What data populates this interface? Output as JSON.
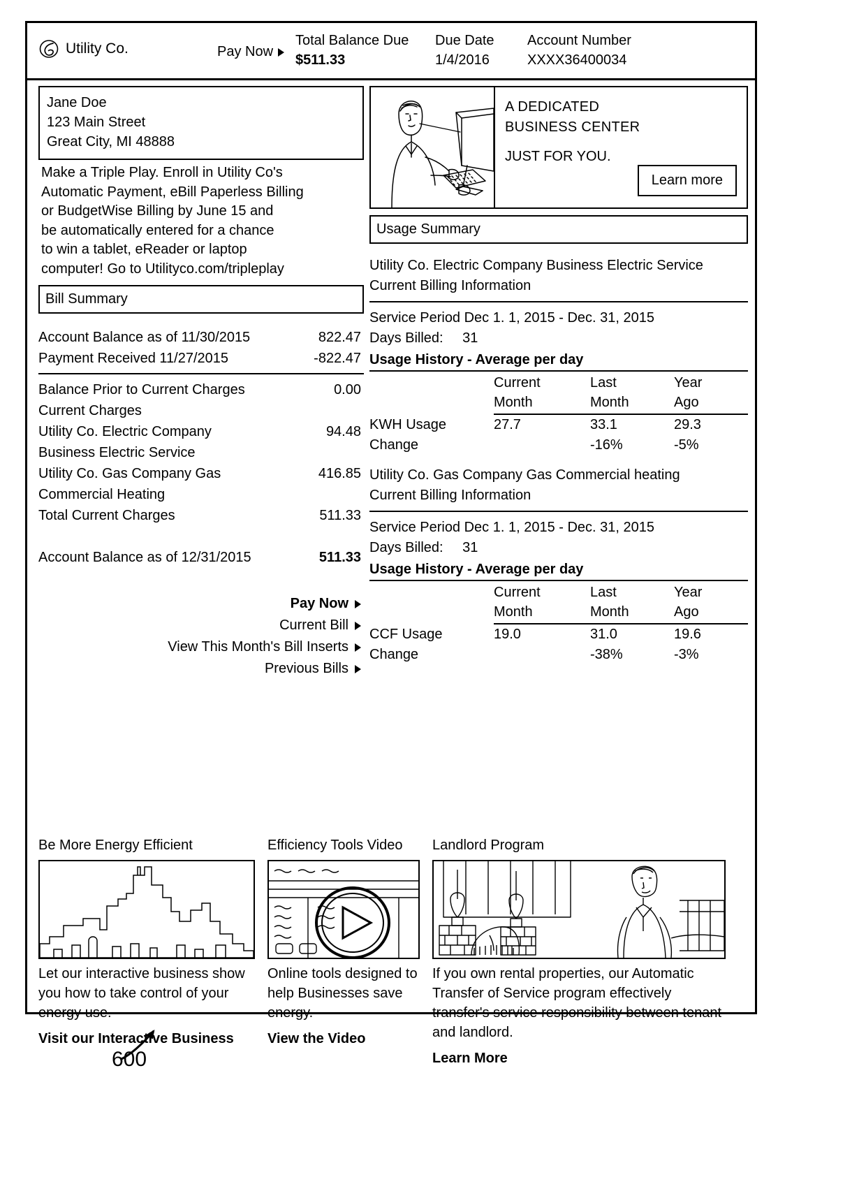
{
  "header": {
    "brand": "Utility Co.",
    "pay_now": "Pay Now",
    "total_balance_label": "Total Balance Due",
    "total_balance_value": "$511.33",
    "due_date_label": "Due Date",
    "due_date_value": "1/4/2016",
    "account_label": "Account Number",
    "account_value": "XXXX36400034"
  },
  "customer": {
    "name": "Jane Doe",
    "street": "123 Main Street",
    "citystate": "Great City, MI 48888"
  },
  "promo": {
    "line1": "Make a Triple Play. Enroll in Utility Co's",
    "line2": "Automatic Payment, eBill Paperless Billing",
    "line3": "or BudgetWise Billing by June 15 and",
    "line4": "be automatically entered for a chance",
    "line5": "to win a tablet, eReader or laptop",
    "line6": "computer! Go to Utilityco.com/tripleplay"
  },
  "ad": {
    "headline1": "A DEDICATED",
    "headline2": "BUSINESS CENTER",
    "headline3": "JUST FOR YOU.",
    "button": "Learn more"
  },
  "bill_summary": {
    "title": "Bill Summary",
    "rows": [
      {
        "label": "Account Balance as of 11/30/2015",
        "value": "822.47"
      },
      {
        "label": "Payment Received 11/27/2015",
        "value": "-822.47"
      }
    ],
    "balance_prior_label": "Balance Prior to Current Charges",
    "balance_prior_value": "0.00",
    "current_charges_label": "Current Charges",
    "charges": [
      {
        "label": "Utility Co. Electric Company",
        "sub": "Business Electric Service",
        "value": "94.48"
      },
      {
        "label": "Utility Co. Gas Company Gas",
        "sub": "Commercial Heating",
        "value": "416.85"
      }
    ],
    "total_label": "Total Current Charges",
    "total_value": "511.33",
    "ending_label": "Account Balance as of 12/31/2015",
    "ending_value": "511.33",
    "links": [
      {
        "label": "Pay Now",
        "bold": true
      },
      {
        "label": "Current Bill",
        "bold": false
      },
      {
        "label": "View This Month's Bill Inserts",
        "bold": false
      },
      {
        "label": "Previous Bills",
        "bold": false
      }
    ]
  },
  "usage_summary": {
    "title": "Usage Summary",
    "sections": [
      {
        "name_line1": "Utility Co. Electric Company Business Electric Service",
        "name_line2": "Current Billing Information",
        "service_period": "Service Period Dec 1. 1, 2015 - Dec. 31, 2015",
        "days_billed_label": "Days Billed:",
        "days_billed_value": "31",
        "history_title": "Usage History - Average per day",
        "columns": [
          "Current\nMonth",
          "Last\nMonth",
          "Year\nAgo"
        ],
        "col1_a": "Current",
        "col1_b": "Month",
        "col2_a": "Last",
        "col2_b": "Month",
        "col3_a": "Year",
        "col3_b": "Ago",
        "usage_label": "KWH Usage",
        "usage_current": "27.7",
        "usage_last": "33.1",
        "usage_year": "29.3",
        "change_label": "Change",
        "change_current": "",
        "change_last": "-16%",
        "change_year": "-5%"
      },
      {
        "name_line1": "Utility Co. Gas Company Gas Commercial heating",
        "name_line2": "Current Billing Information",
        "service_period": "Service Period Dec 1. 1, 2015 - Dec. 31, 2015",
        "days_billed_label": "Days Billed:",
        "days_billed_value": "31",
        "history_title": "Usage History - Average per day",
        "col1_a": "Current",
        "col1_b": "Month",
        "col2_a": "Last",
        "col2_b": "Month",
        "col3_a": "Year",
        "col3_b": "Ago",
        "usage_label": "CCF Usage",
        "usage_current": "19.0",
        "usage_last": "31.0",
        "usage_year": "19.6",
        "change_label": "Change",
        "change_current": "",
        "change_last": "-38%",
        "change_year": "-3%"
      }
    ]
  },
  "cards": [
    {
      "heading": "Be More Energy Efficient",
      "text": "Let our interactive business show you how to take control of your energy use.",
      "cta": "Visit our Interactive Business",
      "image": "city-skyline-illustration"
    },
    {
      "heading": "Efficiency Tools Video",
      "text": "Online tools designed to help Businesses save energy.",
      "cta": "View the Video",
      "image": "video-play-button"
    },
    {
      "heading": "Landlord Program",
      "text": "If you own rental properties, our Automatic Transfer of Service program effectively transfer's service responsibility between tenant and landlord.",
      "cta": "Learn More",
      "image": "landlord-interior-illustration"
    }
  ],
  "figure": {
    "number": "600"
  }
}
